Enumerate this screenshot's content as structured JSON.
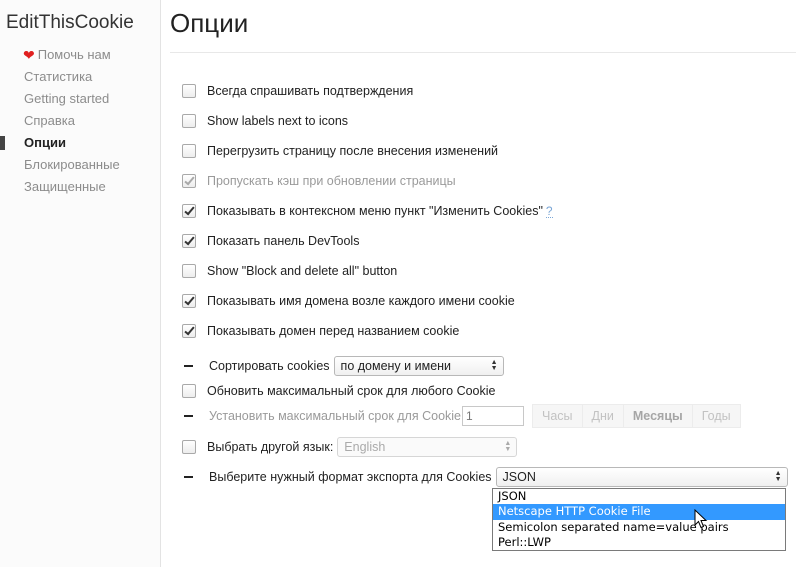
{
  "sidebar": {
    "app_title": "EditThisCookie",
    "items": [
      {
        "label": "Помочь нам"
      },
      {
        "label": "Статистика"
      },
      {
        "label": "Getting started"
      },
      {
        "label": "Справка"
      },
      {
        "label": "Опции"
      },
      {
        "label": "Блокированные"
      },
      {
        "label": "Защищенные"
      }
    ]
  },
  "main": {
    "title": "Опции",
    "options": [
      {
        "label": "Всегда спрашивать подтверждения",
        "checked": false
      },
      {
        "label": "Show labels next to icons",
        "checked": false
      },
      {
        "label": "Перегрузить страницу после внесения изменений",
        "checked": false
      },
      {
        "label": "Пропускать кэш при обновлении страницы",
        "checked": true,
        "disabled": true
      },
      {
        "label": "Показывать в контексном меню пункт \"Изменить Cookies\"",
        "help": "?",
        "checked": true
      },
      {
        "label": "Показать панель DevTools",
        "checked": true
      },
      {
        "label": "Show \"Block and delete all\" button",
        "checked": false
      },
      {
        "label": "Показывать имя домена возле каждого имени cookie",
        "checked": true
      },
      {
        "label": "Показывать домен перед названием cookie",
        "checked": true
      }
    ],
    "sort": {
      "label": "Сортировать cookies",
      "value": "по домену и имени"
    },
    "max_age_toggle": {
      "label": "Обновить максимальный срок для любого Cookie",
      "checked": false
    },
    "max_age": {
      "label": "Установить максимальный срок для Cookie",
      "value": "1",
      "units": [
        "Часы",
        "Дни",
        "Месяцы",
        "Годы"
      ],
      "selected_unit": "Месяцы"
    },
    "language": {
      "label": "Выбрать другой язык:",
      "value": "English",
      "checked": false
    },
    "export": {
      "label": "Выберите нужный формат экспорта для Cookies",
      "value": "JSON",
      "options": [
        "JSON",
        "Netscape HTTP Cookie File",
        "Semicolon separated name=value pairs",
        "Perl::LWP"
      ],
      "highlighted": "Netscape HTTP Cookie File"
    }
  },
  "colors": {
    "accent_heart": "#e02020",
    "highlight": "#3399ff",
    "help_link": "#7aa6d6"
  }
}
